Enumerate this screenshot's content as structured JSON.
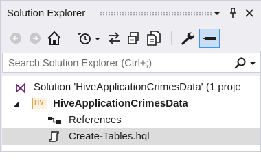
{
  "window": {
    "title": "Solution Explorer"
  },
  "toolbar": {
    "items": [
      "back-icon",
      "forward-icon",
      "home-icon",
      "history-icon",
      "dropdown-icon",
      "sync-icon",
      "collapse-all-icon",
      "show-all-files-icon",
      "properties-icon",
      "preview-icon"
    ],
    "active": "preview-icon"
  },
  "search": {
    "placeholder": "Search Solution Explorer (Ctrl+;)"
  },
  "tree": {
    "solution_label": "Solution 'HiveApplicationCrimesData' (1 proje",
    "project_label": "HiveApplicationCrimesData",
    "project_badge": "HV",
    "references_label": "References",
    "file_label": "Create-Tables.hql"
  },
  "colors": {
    "accent": "#3399ff",
    "project_badge": "#e8a33c",
    "solution_icon": "#68217a"
  }
}
